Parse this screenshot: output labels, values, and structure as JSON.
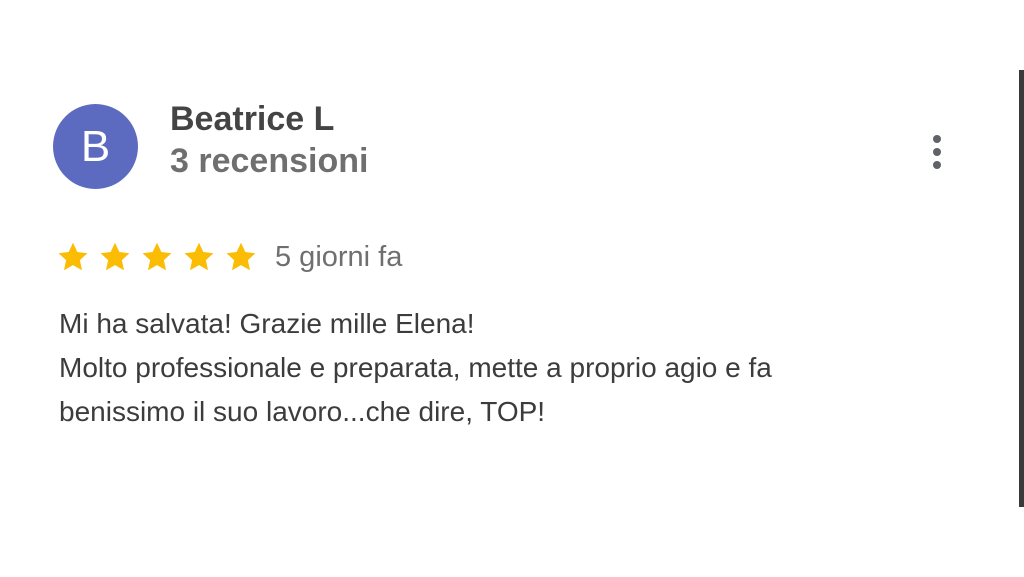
{
  "review": {
    "author": {
      "initial": "B",
      "name": "Beatrice L",
      "review_count": "3 recensioni",
      "avatar_color": "#5c6bc0"
    },
    "menu_icon": "more-vert-icon",
    "rating": 5,
    "rating_max": 5,
    "star_color": "#fbbc04",
    "date": "5 giorni fa",
    "text_lines": [
      "Mi ha salvata! Grazie mille Elena!",
      "Molto professionale e preparata, mette a proprio agio e fa",
      "benissimo il suo lavoro...che dire, TOP!"
    ]
  }
}
